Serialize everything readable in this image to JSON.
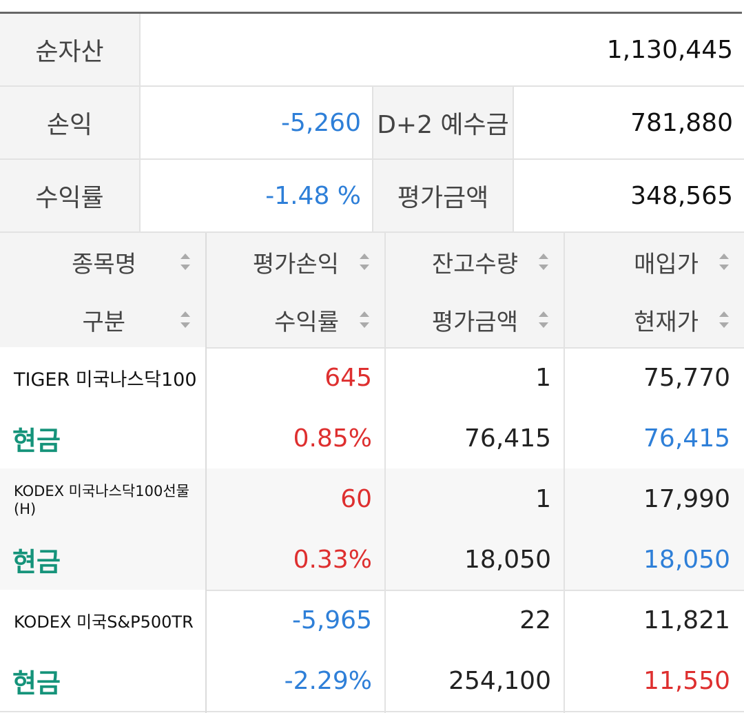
{
  "summary": {
    "net_assets_label": "순자산",
    "net_assets_value": "1,130,445",
    "pnl_label": "손익",
    "pnl_value": "-5,260",
    "deposit_label": "D+2 예수금",
    "deposit_value": "781,880",
    "return_label": "수익률",
    "return_value": "-1.48 %",
    "eval_label": "평가금액",
    "eval_value": "348,565"
  },
  "holdings_header": {
    "col1_top": "종목명",
    "col1_bottom": "구분",
    "col2_top": "평가손익",
    "col2_bottom": "수익률",
    "col3_top": "잔고수량",
    "col3_bottom": "평가금액",
    "col4_top": "매입가",
    "col4_bottom": "현재가",
    "sort_icon": "sort-updown-icon"
  },
  "holdings": [
    {
      "name": "TIGER 미국나스닥100",
      "type": "현금",
      "pnl": "645",
      "return": "0.85%",
      "quantity": "1",
      "eval_amount": "76,415",
      "buy_price": "75,770",
      "current_price": "76,415"
    },
    {
      "name": "KODEX 미국나스닥100선물(H)",
      "type": "현금",
      "pnl": "60",
      "return": "0.33%",
      "quantity": "1",
      "eval_amount": "18,050",
      "buy_price": "17,990",
      "current_price": "18,050"
    },
    {
      "name": "KODEX 미국S&P500TR",
      "type": "현금",
      "pnl": "-5,965",
      "return": "-2.29%",
      "quantity": "22",
      "eval_amount": "254,100",
      "buy_price": "11,821",
      "current_price": "11,550"
    }
  ],
  "colors": {
    "negative": "#2e7fd8",
    "positive": "#de2f2f",
    "type_text": "#15937a"
  }
}
